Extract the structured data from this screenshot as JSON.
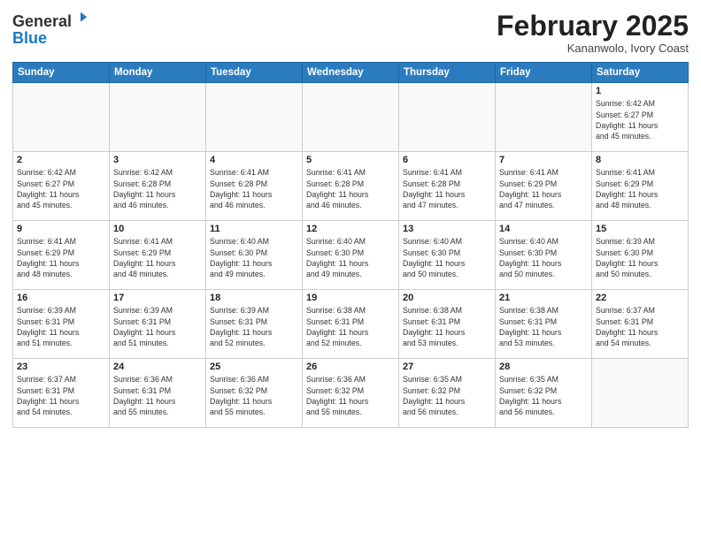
{
  "header": {
    "logo_general": "General",
    "logo_blue": "Blue",
    "month_title": "February 2025",
    "location": "Kananwolo, Ivory Coast"
  },
  "days_of_week": [
    "Sunday",
    "Monday",
    "Tuesday",
    "Wednesday",
    "Thursday",
    "Friday",
    "Saturday"
  ],
  "weeks": [
    [
      {
        "day": "",
        "info": ""
      },
      {
        "day": "",
        "info": ""
      },
      {
        "day": "",
        "info": ""
      },
      {
        "day": "",
        "info": ""
      },
      {
        "day": "",
        "info": ""
      },
      {
        "day": "",
        "info": ""
      },
      {
        "day": "1",
        "info": "Sunrise: 6:42 AM\nSunset: 6:27 PM\nDaylight: 11 hours\nand 45 minutes."
      }
    ],
    [
      {
        "day": "2",
        "info": "Sunrise: 6:42 AM\nSunset: 6:27 PM\nDaylight: 11 hours\nand 45 minutes."
      },
      {
        "day": "3",
        "info": "Sunrise: 6:42 AM\nSunset: 6:28 PM\nDaylight: 11 hours\nand 46 minutes."
      },
      {
        "day": "4",
        "info": "Sunrise: 6:41 AM\nSunset: 6:28 PM\nDaylight: 11 hours\nand 46 minutes."
      },
      {
        "day": "5",
        "info": "Sunrise: 6:41 AM\nSunset: 6:28 PM\nDaylight: 11 hours\nand 46 minutes."
      },
      {
        "day": "6",
        "info": "Sunrise: 6:41 AM\nSunset: 6:28 PM\nDaylight: 11 hours\nand 47 minutes."
      },
      {
        "day": "7",
        "info": "Sunrise: 6:41 AM\nSunset: 6:29 PM\nDaylight: 11 hours\nand 47 minutes."
      },
      {
        "day": "8",
        "info": "Sunrise: 6:41 AM\nSunset: 6:29 PM\nDaylight: 11 hours\nand 48 minutes."
      }
    ],
    [
      {
        "day": "9",
        "info": "Sunrise: 6:41 AM\nSunset: 6:29 PM\nDaylight: 11 hours\nand 48 minutes."
      },
      {
        "day": "10",
        "info": "Sunrise: 6:41 AM\nSunset: 6:29 PM\nDaylight: 11 hours\nand 48 minutes."
      },
      {
        "day": "11",
        "info": "Sunrise: 6:40 AM\nSunset: 6:30 PM\nDaylight: 11 hours\nand 49 minutes."
      },
      {
        "day": "12",
        "info": "Sunrise: 6:40 AM\nSunset: 6:30 PM\nDaylight: 11 hours\nand 49 minutes."
      },
      {
        "day": "13",
        "info": "Sunrise: 6:40 AM\nSunset: 6:30 PM\nDaylight: 11 hours\nand 50 minutes."
      },
      {
        "day": "14",
        "info": "Sunrise: 6:40 AM\nSunset: 6:30 PM\nDaylight: 11 hours\nand 50 minutes."
      },
      {
        "day": "15",
        "info": "Sunrise: 6:39 AM\nSunset: 6:30 PM\nDaylight: 11 hours\nand 50 minutes."
      }
    ],
    [
      {
        "day": "16",
        "info": "Sunrise: 6:39 AM\nSunset: 6:31 PM\nDaylight: 11 hours\nand 51 minutes."
      },
      {
        "day": "17",
        "info": "Sunrise: 6:39 AM\nSunset: 6:31 PM\nDaylight: 11 hours\nand 51 minutes."
      },
      {
        "day": "18",
        "info": "Sunrise: 6:39 AM\nSunset: 6:31 PM\nDaylight: 11 hours\nand 52 minutes."
      },
      {
        "day": "19",
        "info": "Sunrise: 6:38 AM\nSunset: 6:31 PM\nDaylight: 11 hours\nand 52 minutes."
      },
      {
        "day": "20",
        "info": "Sunrise: 6:38 AM\nSunset: 6:31 PM\nDaylight: 11 hours\nand 53 minutes."
      },
      {
        "day": "21",
        "info": "Sunrise: 6:38 AM\nSunset: 6:31 PM\nDaylight: 11 hours\nand 53 minutes."
      },
      {
        "day": "22",
        "info": "Sunrise: 6:37 AM\nSunset: 6:31 PM\nDaylight: 11 hours\nand 54 minutes."
      }
    ],
    [
      {
        "day": "23",
        "info": "Sunrise: 6:37 AM\nSunset: 6:31 PM\nDaylight: 11 hours\nand 54 minutes."
      },
      {
        "day": "24",
        "info": "Sunrise: 6:36 AM\nSunset: 6:31 PM\nDaylight: 11 hours\nand 55 minutes."
      },
      {
        "day": "25",
        "info": "Sunrise: 6:36 AM\nSunset: 6:32 PM\nDaylight: 11 hours\nand 55 minutes."
      },
      {
        "day": "26",
        "info": "Sunrise: 6:36 AM\nSunset: 6:32 PM\nDaylight: 11 hours\nand 55 minutes."
      },
      {
        "day": "27",
        "info": "Sunrise: 6:35 AM\nSunset: 6:32 PM\nDaylight: 11 hours\nand 56 minutes."
      },
      {
        "day": "28",
        "info": "Sunrise: 6:35 AM\nSunset: 6:32 PM\nDaylight: 11 hours\nand 56 minutes."
      },
      {
        "day": "",
        "info": ""
      }
    ]
  ]
}
